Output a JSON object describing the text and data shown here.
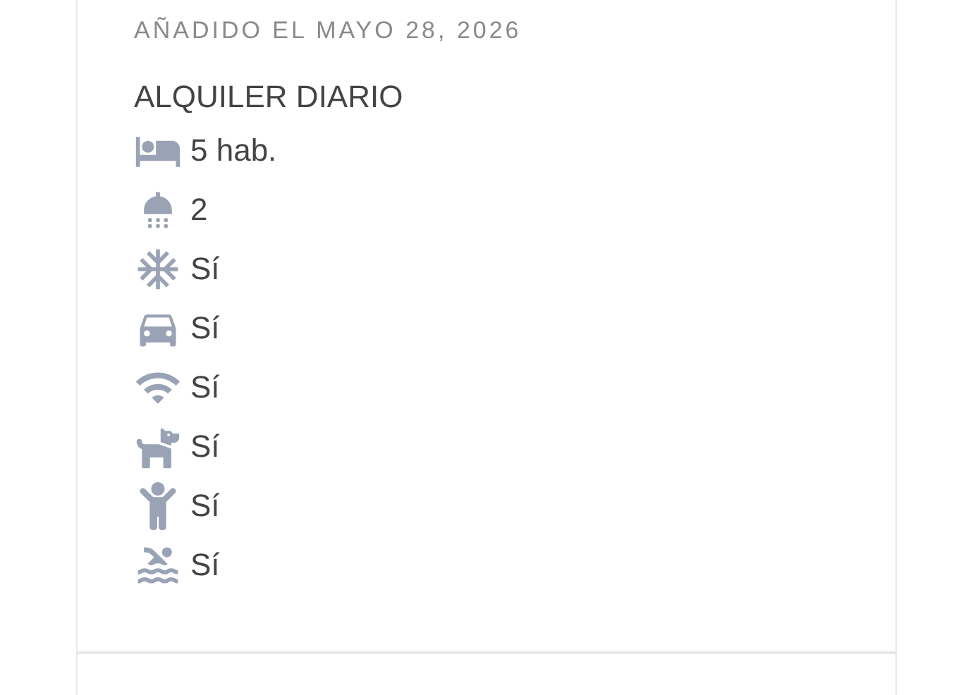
{
  "listing": {
    "added_date": "AÑADIDO EL MAYO 28, 2026",
    "rental_type": "ALQUILER DIARIO",
    "features": [
      {
        "kind": "bed",
        "value": "5 hab."
      },
      {
        "kind": "shower",
        "value": "2"
      },
      {
        "kind": "snowflake",
        "value": "Sí"
      },
      {
        "kind": "car",
        "value": "Sí"
      },
      {
        "kind": "wifi",
        "value": "Sí"
      },
      {
        "kind": "dog",
        "value": "Sí"
      },
      {
        "kind": "child",
        "value": "Sí"
      },
      {
        "kind": "pool",
        "value": "Sí"
      }
    ]
  }
}
